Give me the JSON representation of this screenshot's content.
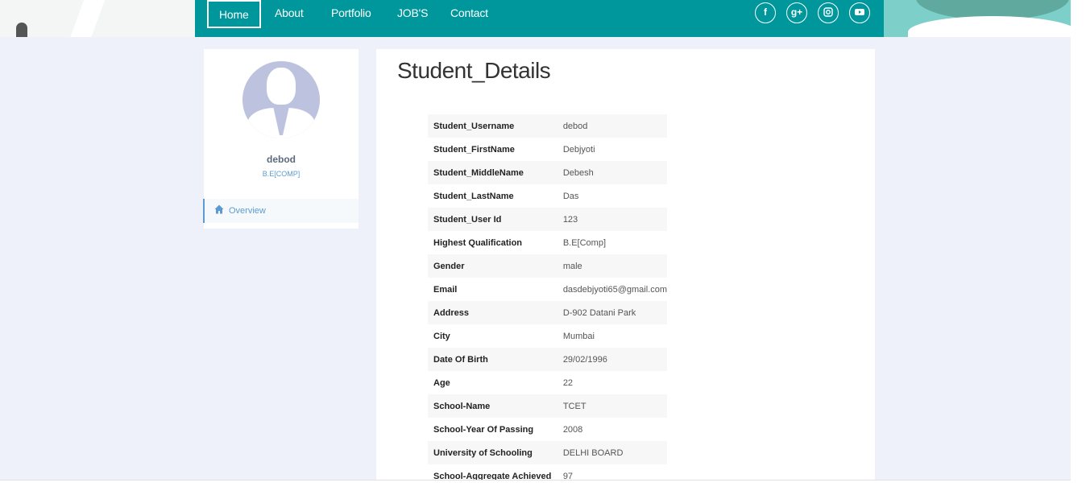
{
  "nav": {
    "items": [
      "Home",
      "About",
      "Portfolio",
      "JOB'S",
      "Contact"
    ],
    "social": [
      "f",
      "g+",
      "ig",
      "yt"
    ]
  },
  "profile": {
    "name": "debod",
    "qualification": "B.E[COMP]",
    "menu": "Overview"
  },
  "main": {
    "title": "Student_Details",
    "rows": [
      {
        "label": "Student_Username",
        "value": "debod"
      },
      {
        "label": "Student_FirstName",
        "value": "Debjyoti"
      },
      {
        "label": "Student_MiddleName",
        "value": "Debesh"
      },
      {
        "label": "Student_LastName",
        "value": "Das"
      },
      {
        "label": "Student_User Id",
        "value": "123"
      },
      {
        "label": "Highest Qualification",
        "value": "B.E[Comp]"
      },
      {
        "label": "Gender",
        "value": "male"
      },
      {
        "label": "Email",
        "value": "dasdebjyoti65@gmail.com"
      },
      {
        "label": "Address",
        "value": "D-902 Datani Park"
      },
      {
        "label": "City",
        "value": "Mumbai"
      },
      {
        "label": "Date Of Birth",
        "value": "29/02/1996"
      },
      {
        "label": "Age",
        "value": "22"
      },
      {
        "label": "School-Name",
        "value": "TCET"
      },
      {
        "label": "School-Year Of Passing",
        "value": "2008"
      },
      {
        "label": "University of Schooling",
        "value": "DELHI BOARD"
      },
      {
        "label": "School-Aggregate Achieved",
        "value": "97"
      }
    ]
  },
  "colors": {
    "nav_bg": "#00979c",
    "page_bg": "#eef1f9",
    "accent": "#5b9bd1"
  }
}
